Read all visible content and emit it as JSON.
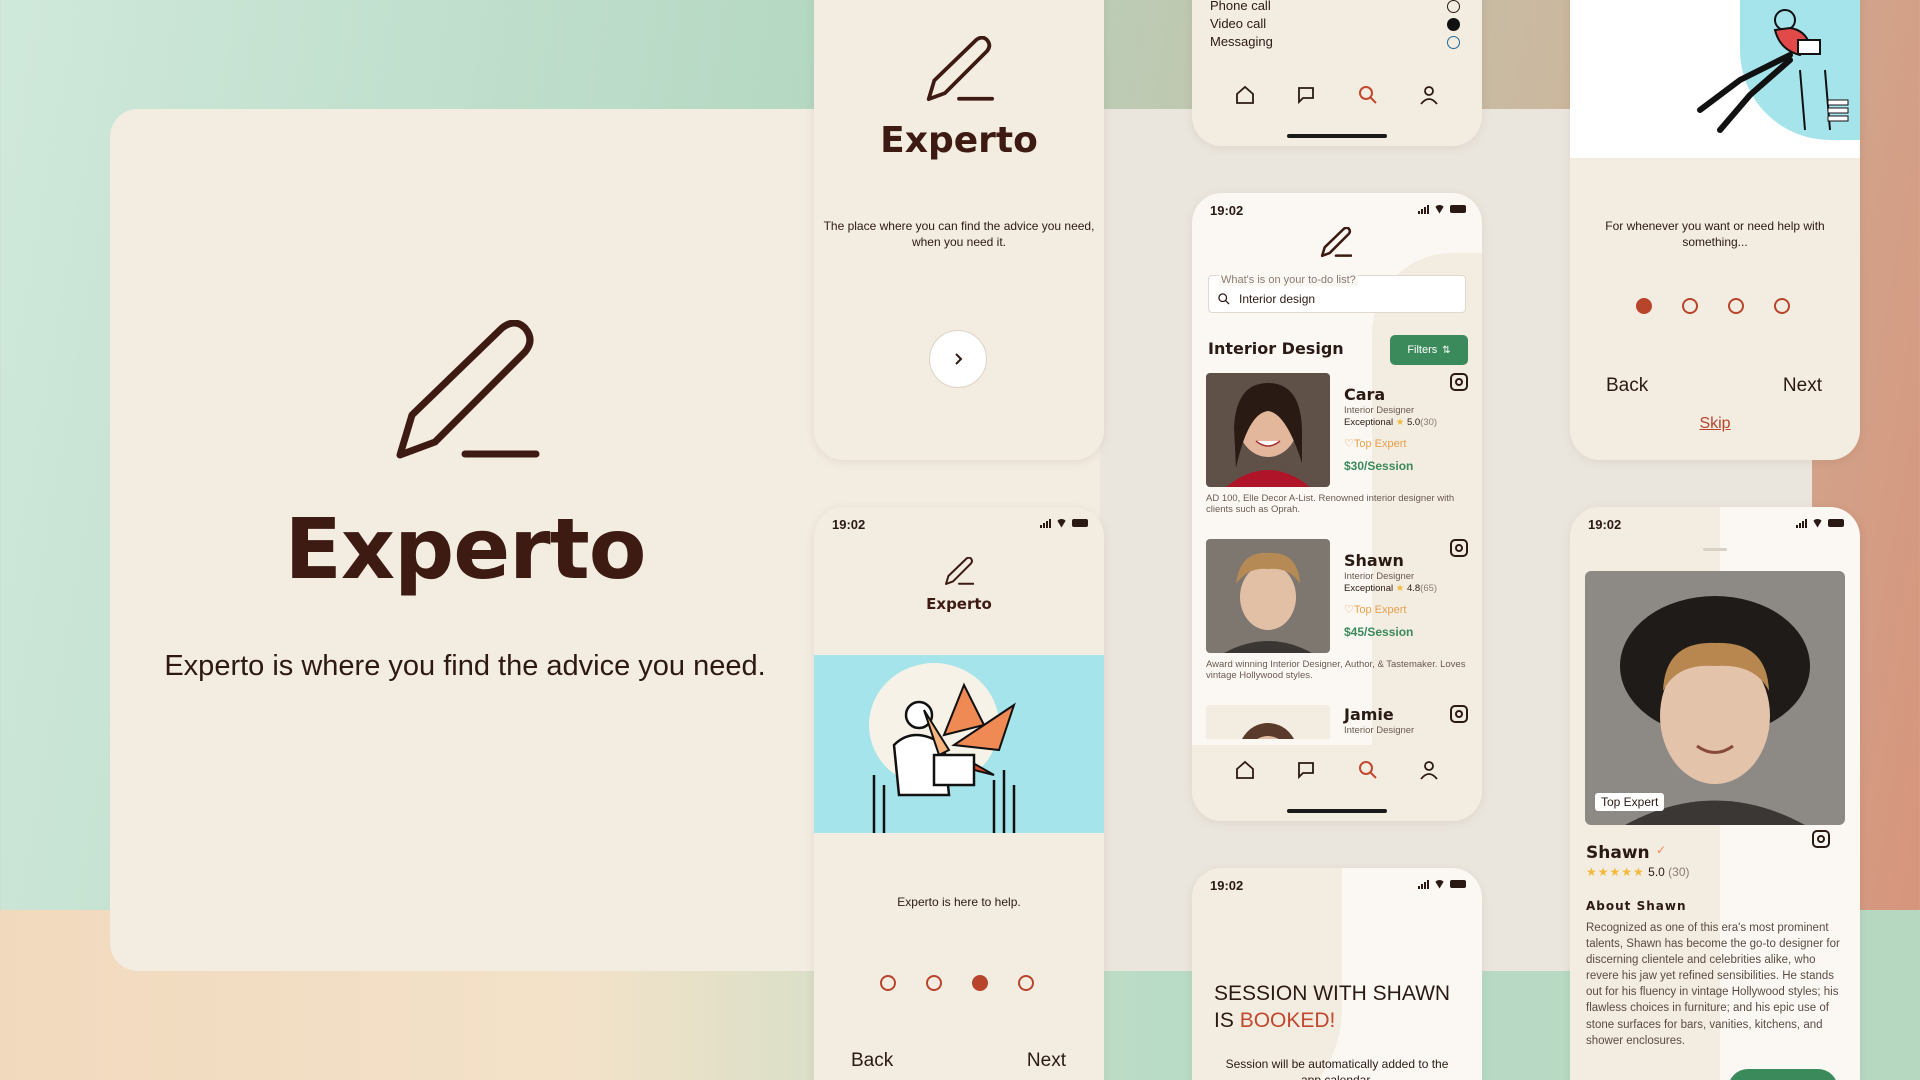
{
  "brand": {
    "name": "Experto",
    "tagline": "Experto is where you find the advice you need."
  },
  "splash": {
    "title": "Experto",
    "subtitle": "The place where you can find the advice you need, when you need it."
  },
  "contact_screen": {
    "options": [
      {
        "label": "Phone call",
        "selected": false
      },
      {
        "label": "Video call",
        "selected": true
      },
      {
        "label": "Messaging",
        "selected": false
      }
    ]
  },
  "onboarding_right": {
    "text": "For whenever you want or need help with something...",
    "back": "Back",
    "next": "Next",
    "skip": "Skip",
    "active_step": 1
  },
  "onboarding_left": {
    "time": "19:02",
    "title": "Experto",
    "text": "Experto is here to help.",
    "back": "Back",
    "next": "Next",
    "active_step": 3
  },
  "search_screen": {
    "time": "19:02",
    "search_label": "What's is on your to-do list?",
    "search_value": "Interior design",
    "section_title": "Interior Design",
    "filters_label": "Filters",
    "experts": [
      {
        "name": "Cara",
        "role": "Interior Designer",
        "rating_label": "Exceptional",
        "rating": "5.0",
        "count": "(30)",
        "badge": "Top Expert",
        "price": "$30/Session",
        "desc": "AD 100, Elle Decor A-List. Renowned interior designer with clients such as Oprah."
      },
      {
        "name": "Shawn",
        "role": "Interior Designer",
        "rating_label": "Exceptional",
        "rating": "4.8",
        "count": "(65)",
        "badge": "Top Expert",
        "price": "$45/Session",
        "desc": "Award winning Interior Designer, Author, & Tastemaker. Loves vintage Hollywood styles."
      },
      {
        "name": "Jamie",
        "role": "Interior Designer"
      }
    ]
  },
  "booked_screen": {
    "time": "19:02",
    "line1": "SESSION WITH SHAWN",
    "line2_prefix": "IS ",
    "line2_highlight": "BOOKED!",
    "note": "Session will be automatically added to the app calendar."
  },
  "profile_screen": {
    "time": "19:02",
    "badge": "Top Expert",
    "name": "Shawn",
    "rating": "5.0",
    "count": "(30)",
    "about_title": "About Shawn",
    "about_text": "Recognized as one of this era's most prominent talents, Shawn has become the go-to designer for discerning clientele and celebrities alike, who revere his jaw yet refined sensibilities. He stands out for his fluency in vintage Hollywood styles; his flawless choices in furniture; and his epic use of stone surfaces for bars, vanities, kitchens, and shower enclosures."
  },
  "colors": {
    "accent": "#b8442c",
    "brown": "#3d1a12",
    "green": "#3b8a5c",
    "cream": "#f3ece1",
    "illustration_blue": "#a6e4ec"
  }
}
